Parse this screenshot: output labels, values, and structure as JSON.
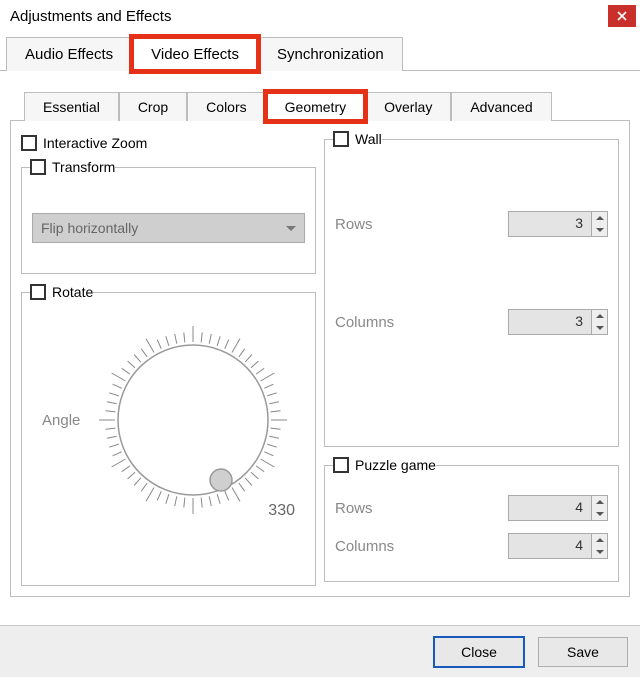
{
  "title": "Adjustments and Effects",
  "mainTabs": {
    "audio": "Audio Effects",
    "video": "Video Effects",
    "sync": "Synchronization"
  },
  "subTabs": {
    "essential": "Essential",
    "crop": "Crop",
    "colors": "Colors",
    "geometry": "Geometry",
    "overlay": "Overlay",
    "advanced": "Advanced"
  },
  "geometry": {
    "interactiveZoom": "Interactive Zoom",
    "transform": {
      "label": "Transform",
      "selected": "Flip horizontally"
    },
    "rotate": {
      "label": "Rotate",
      "angleLabel": "Angle",
      "angleValue": "330"
    },
    "wall": {
      "label": "Wall",
      "rowsLabel": "Rows",
      "rowsValue": "3",
      "colsLabel": "Columns",
      "colsValue": "3"
    },
    "puzzle": {
      "label": "Puzzle game",
      "rowsLabel": "Rows",
      "rowsValue": "4",
      "colsLabel": "Columns",
      "colsValue": "4"
    }
  },
  "buttons": {
    "close": "Close",
    "save": "Save"
  }
}
